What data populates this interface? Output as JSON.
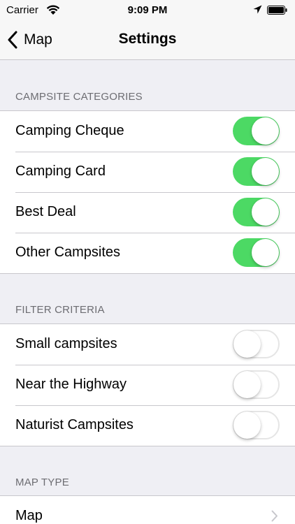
{
  "status_bar": {
    "carrier": "Carrier",
    "time": "9:09 PM"
  },
  "nav": {
    "back_label": "Map",
    "title": "Settings"
  },
  "sections": {
    "categories": {
      "header": "CAMPSITE CATEGORIES",
      "items": [
        {
          "label": "Camping Cheque",
          "on": true
        },
        {
          "label": "Camping Card",
          "on": true
        },
        {
          "label": "Best Deal",
          "on": true
        },
        {
          "label": "Other Campsites",
          "on": true
        }
      ]
    },
    "filters": {
      "header": "FILTER CRITERIA",
      "items": [
        {
          "label": "Small campsites",
          "on": false
        },
        {
          "label": "Near the Highway",
          "on": false
        },
        {
          "label": "Naturist Campsites",
          "on": false
        }
      ]
    },
    "map_type": {
      "header": "MAP TYPE",
      "items": [
        {
          "label": "Map"
        }
      ]
    }
  },
  "colors": {
    "switch_on": "#4cd964",
    "background": "#efeff4"
  }
}
